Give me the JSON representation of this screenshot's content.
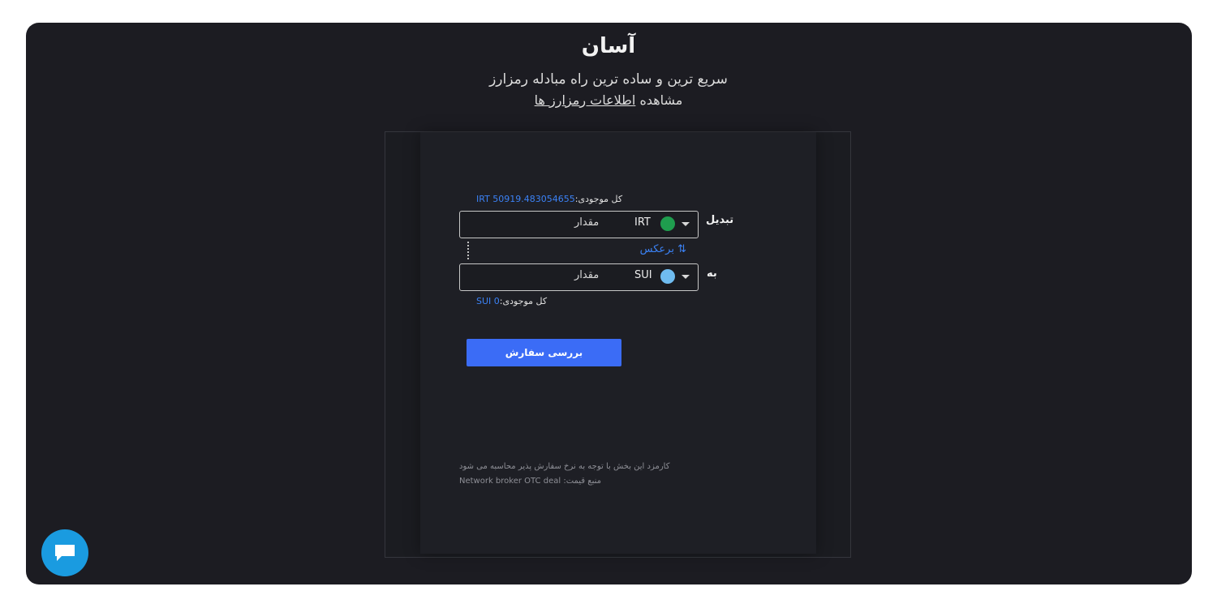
{
  "header": {
    "title": "آسان",
    "subtitle": "سریع ترین و ساده ترین راه مبادله رمزارز",
    "link_prefix": "مشاهده",
    "link_text": "اطلاعات رمزارز ها"
  },
  "form": {
    "from": {
      "label": "تبدیل",
      "balance_label": "کل موجودی:",
      "balance_value": "IRT 50919.483054655",
      "coin_code": "IRT",
      "coin_icon": "toman-icon",
      "amount_placeholder": "مقدار"
    },
    "swap_label": "برعکس",
    "to": {
      "label": "به",
      "balance_label": "کل موجودی:",
      "balance_value": "SUI 0",
      "coin_code": "SUI",
      "coin_icon": "sui-icon",
      "amount_placeholder": "مقدار"
    },
    "submit_label": "بررسی سفارش",
    "footnote_fee": "کارمزد این بخش با توجه به نرخ سفارش پذیر محاسبه می شود",
    "footnote_source": "منبع قیمت: Network broker OTC deal"
  },
  "colors": {
    "background": "#1c1c22",
    "accent": "#3b6cf6",
    "link": "#3b82f6",
    "chat": "#1a9be0"
  },
  "chat": {
    "icon": "chat-icon"
  }
}
